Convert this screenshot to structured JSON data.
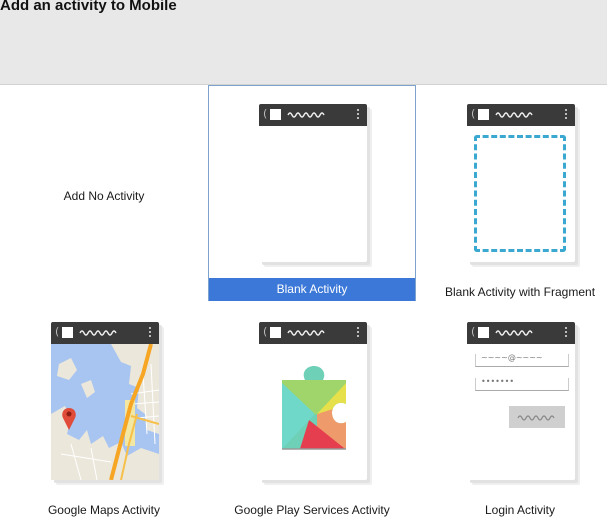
{
  "header": {
    "title": "Add an activity to Mobile"
  },
  "activities": [
    {
      "label": "Add No Activity"
    },
    {
      "label": "Blank Activity",
      "selected": true
    },
    {
      "label": "Blank Activity with Fragment"
    },
    {
      "label": "Google Maps Activity"
    },
    {
      "label": "Google Play Services Activity"
    },
    {
      "label": "Login Activity"
    }
  ],
  "phone": {
    "bar_icon": "app-bar-icon",
    "menu_icon": "overflow-menu-icon"
  },
  "login": {
    "username_hint": "~~~~@~~~~",
    "password_hint": "•••••••"
  },
  "colors": {
    "selection": "#3c78d8",
    "selection_border": "#7da2ce",
    "fragment_dash": "#3aa8d0",
    "phone_bar": "#3a3a3a",
    "header_bg": "#e8e8e8"
  }
}
